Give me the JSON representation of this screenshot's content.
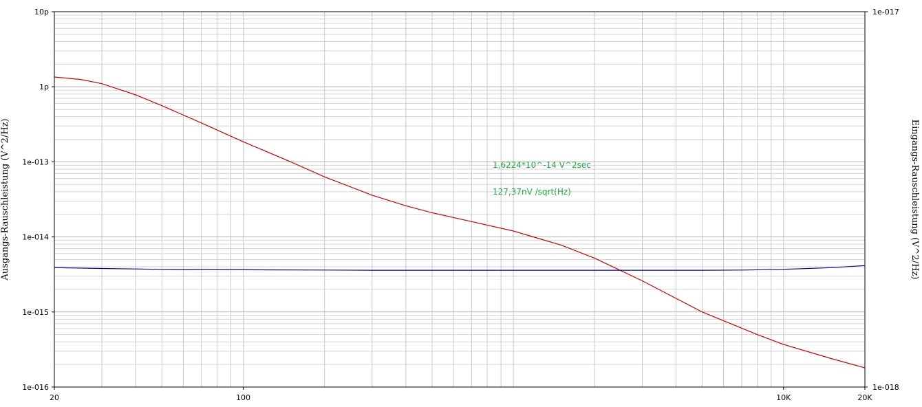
{
  "chart_data": {
    "type": "line",
    "title": "",
    "xlabel": "",
    "ylabel_left": "Ausgangs-Rauschleistung (V^2/Hz)",
    "ylabel_right": "Eingangs-Rauschleistung (V^2/Hz)",
    "x_scale": "log",
    "xlim": [
      20,
      20000
    ],
    "x_tick_labels": [
      {
        "value": 20,
        "label": "20"
      },
      {
        "value": 100,
        "label": "100"
      },
      {
        "value": 10000,
        "label": "10K"
      },
      {
        "value": 20000,
        "label": "20K"
      }
    ],
    "y_left": {
      "scale": "log",
      "ylim": [
        1e-16,
        1e-11
      ],
      "tick_labels": [
        {
          "value": 1e-11,
          "label": "10p"
        },
        {
          "value": 1e-12,
          "label": "1p"
        },
        {
          "value": 1e-13,
          "label": "1e-013"
        },
        {
          "value": 1e-14,
          "label": "1e-014"
        },
        {
          "value": 1e-15,
          "label": "1e-015"
        },
        {
          "value": 1e-16,
          "label": "1e-016"
        }
      ]
    },
    "y_right": {
      "scale": "log",
      "ylim": [
        1e-18,
        1e-17
      ],
      "tick_labels": [
        {
          "value": 1e-17,
          "label": "1e-017"
        },
        {
          "value": 1e-18,
          "label": "1e-018"
        }
      ]
    },
    "grid": true,
    "series": [
      {
        "color": "#cc0000",
        "axis": "left",
        "x": [
          20,
          25,
          30,
          40,
          50,
          70,
          100,
          150,
          200,
          300,
          400,
          500,
          700,
          1000,
          1500,
          2000,
          3000,
          5000,
          8000,
          10000,
          15000,
          20000
        ],
        "y": [
          1.35e-12,
          1.25e-12,
          1.1e-12,
          7.8e-13,
          5.6e-13,
          3.3e-13,
          1.85e-13,
          1e-13,
          6.3e-14,
          3.6e-14,
          2.6e-14,
          2.1e-14,
          1.6e-14,
          1.2e-14,
          7.8e-15,
          5.2e-15,
          2.6e-15,
          1e-15,
          5e-16,
          3.7e-16,
          2.4e-16,
          1.8e-16
        ]
      },
      {
        "color": "#000099",
        "axis": "left",
        "x": [
          20,
          30,
          50,
          100,
          200,
          300,
          500,
          1000,
          2000,
          3000,
          5000,
          7000,
          10000,
          15000,
          20000
        ],
        "y": [
          3.9e-15,
          3.8e-15,
          3.7e-15,
          3.65e-15,
          3.62e-15,
          3.6e-15,
          3.6e-15,
          3.6e-15,
          3.6e-15,
          3.6e-15,
          3.6e-15,
          3.62e-15,
          3.7e-15,
          3.9e-15,
          4.15e-15
        ]
      }
    ],
    "annotations": [
      {
        "text": "1,6224*10^-14 V^2sec",
        "color": "#22aa44"
      },
      {
        "text": "127,37nV /sqrt(Hz)",
        "color": "#22aa44"
      }
    ]
  }
}
